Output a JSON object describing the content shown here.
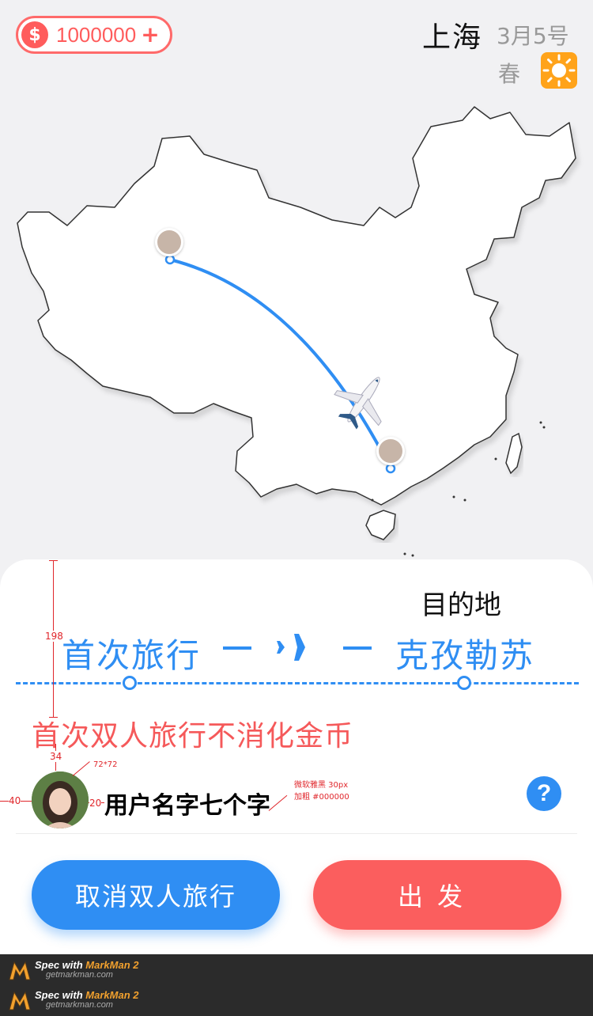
{
  "status": {
    "coins": "1000000",
    "coin_symbol": "$",
    "coin_plus": "+",
    "city": "上海",
    "date": "3月5号",
    "season": "春",
    "weather_icon": "sun-icon"
  },
  "sheet": {
    "destination_label": "目的地",
    "from": "首次旅行",
    "to": "克孜勒苏",
    "promo": "首次双人旅行不消化金币",
    "username": "用户名字七个字",
    "help_symbol": "?",
    "cancel_button": "取消双人旅行",
    "go_button": "出发"
  },
  "annotations": {
    "height_198": "198",
    "gap_34": "34",
    "avatar_size": "72*72",
    "left_40": "40",
    "gap_20": "20",
    "font_note_1": "微软雅黑 30px",
    "font_note_2": "加粗 #000000"
  },
  "footer": {
    "spec_prefix": "Spec with ",
    "brand": "MarkMan 2",
    "site": "getmarkman.com"
  },
  "colors": {
    "accent_blue": "#2f8ef3",
    "accent_red": "#fb5e5e",
    "coin_red": "#ff5c5c",
    "weather_orange": "#ffa31a"
  }
}
